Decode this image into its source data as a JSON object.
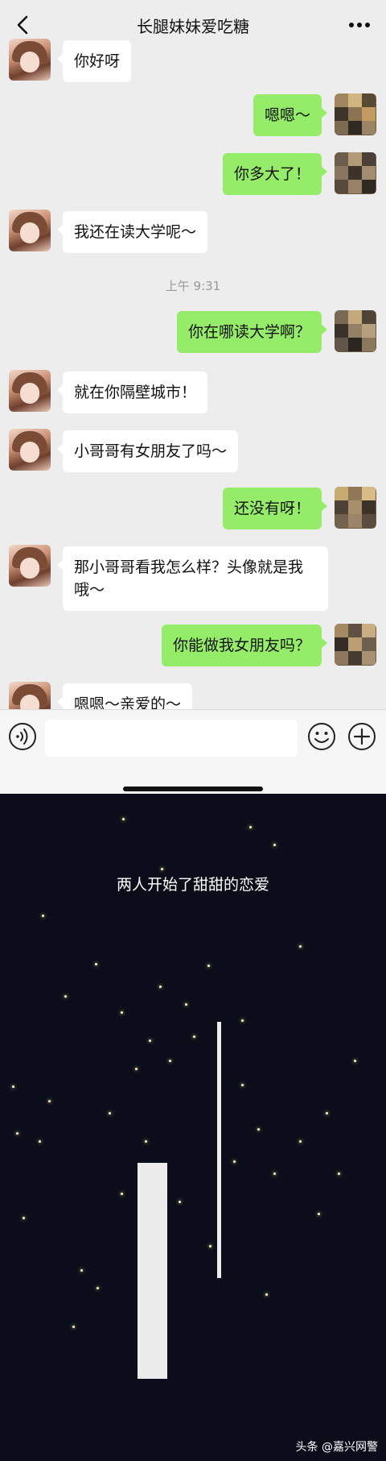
{
  "header": {
    "title": "长腿妹妹爱吃糖"
  },
  "messages": [
    {
      "side": "in",
      "text": "你好呀"
    },
    {
      "side": "out",
      "text": "嗯嗯～"
    },
    {
      "side": "out",
      "text": "你多大了！"
    },
    {
      "side": "in",
      "text": "我还在读大学呢～"
    },
    {
      "side": "out",
      "text": "你在哪读大学啊？"
    },
    {
      "side": "in",
      "text": "就在你隔壁城市！"
    },
    {
      "side": "in",
      "text": "小哥哥有女朋友了吗～"
    },
    {
      "side": "out",
      "text": "还没有呀！"
    },
    {
      "side": "in",
      "text": "那小哥哥看我怎么样？头像就是我哦～"
    },
    {
      "side": "out",
      "text": "你能做我女朋友吗？"
    },
    {
      "side": "in",
      "text": "嗯嗯～亲爱的～"
    }
  ],
  "timestamp": "上午 9:31",
  "input": {
    "placeholder": ""
  },
  "night": {
    "caption": "两人开始了甜甜的恋爱"
  },
  "watermark": "头条 @嘉兴网警",
  "icons": {
    "back": "chevron-left-icon",
    "more": "more-icon",
    "voice": "voice-icon",
    "emoji": "emoji-icon",
    "plus": "plus-icon"
  },
  "colors": {
    "chat_bg": "#ededed",
    "out_bubble": "#95ec69",
    "in_bubble": "#ffffff",
    "night_bg": "#0b0e1a"
  }
}
